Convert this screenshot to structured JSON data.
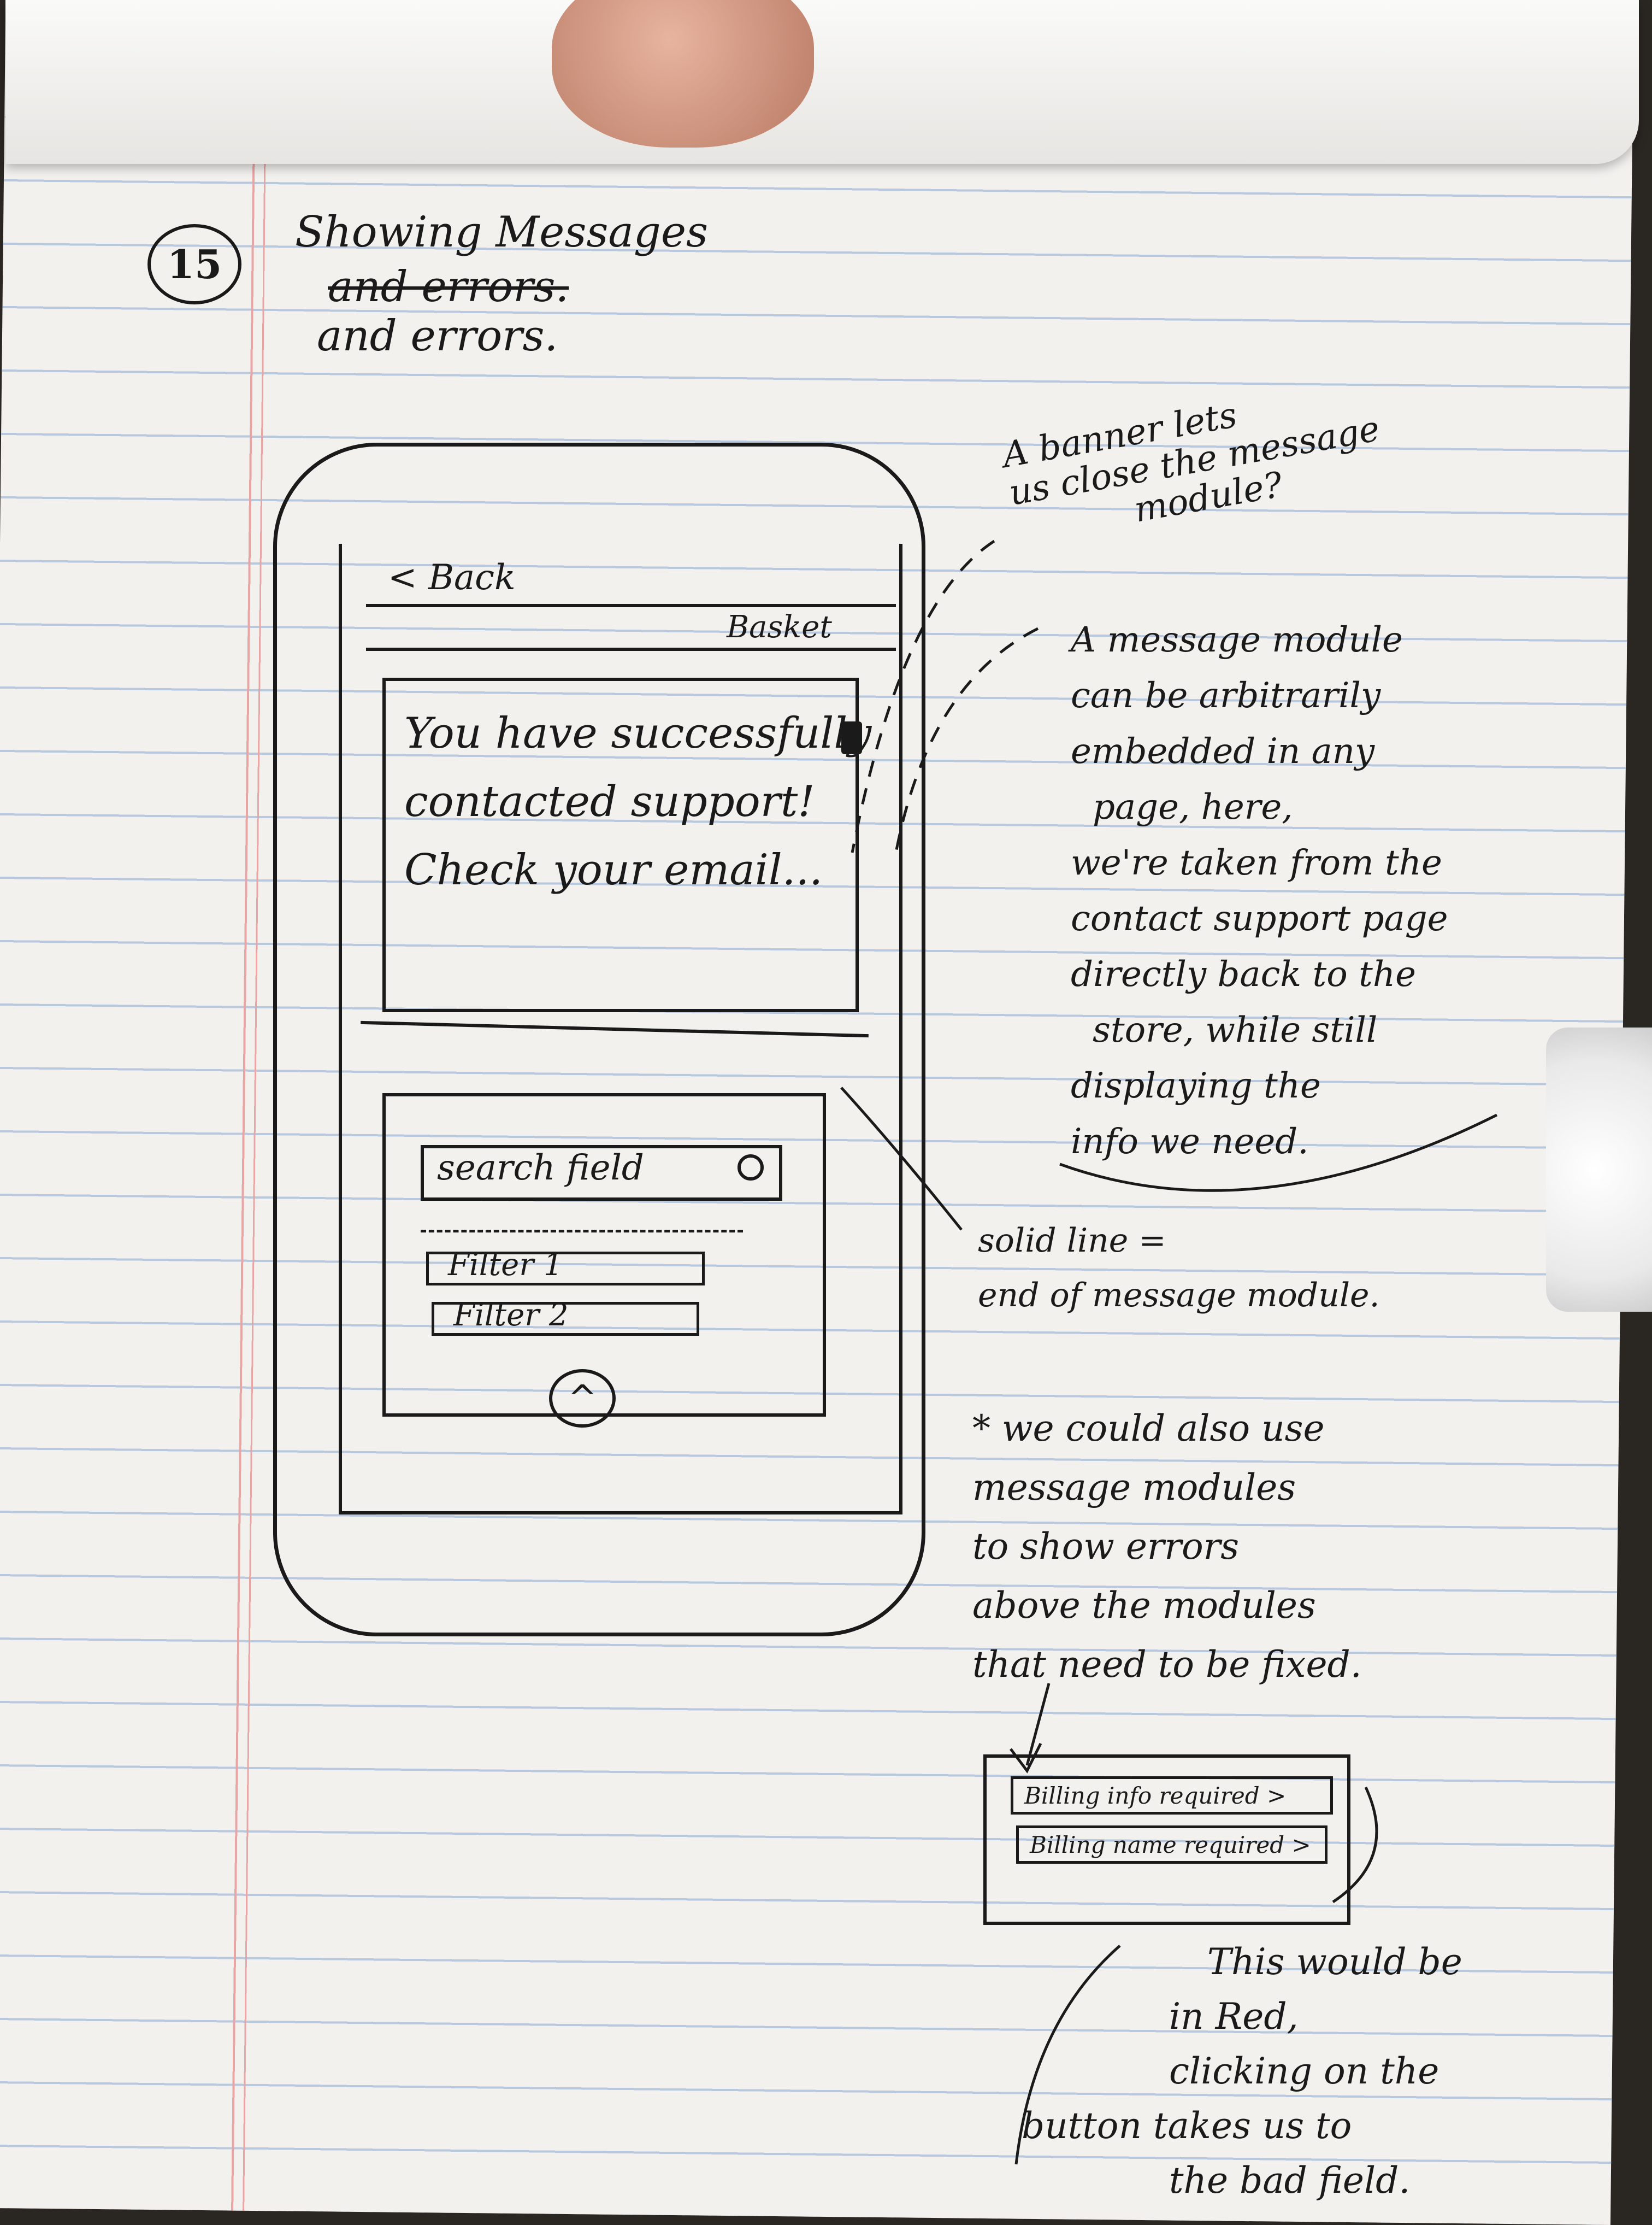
{
  "sheet": {
    "number": "15",
    "title": "Showing Messages",
    "struck": "and errors.",
    "title_cont": "and errors."
  },
  "phone": {
    "back_label": "< Back",
    "basket_label": "Basket",
    "message_lines": [
      "You have successfully",
      "contacted support!",
      "Check your email..."
    ],
    "search_placeholder": "search field",
    "filters": [
      "Filter 1",
      "Filter 2"
    ]
  },
  "annotations": {
    "banner_lines": [
      "A banner lets",
      "us close the message",
      "module?"
    ],
    "module_lines": [
      "A message module",
      "can be arbitrarily",
      "embedded in any",
      "page, here,",
      "we're taken from the",
      "contact support page",
      "directly back to the",
      "store, while still",
      "displaying the",
      "info we need."
    ],
    "solid_line_lines": [
      "solid line =",
      "end of message module."
    ],
    "errors_lines": [
      "* we could also use",
      "message modules",
      "to show errors",
      "above the modules",
      "that need to be fixed."
    ],
    "error_buttons": [
      "Billing info required >",
      "Billing name required >"
    ],
    "red_lines": [
      "This would be",
      "in Red,",
      "clicking on the",
      "button takes us to",
      "the bad field."
    ]
  }
}
